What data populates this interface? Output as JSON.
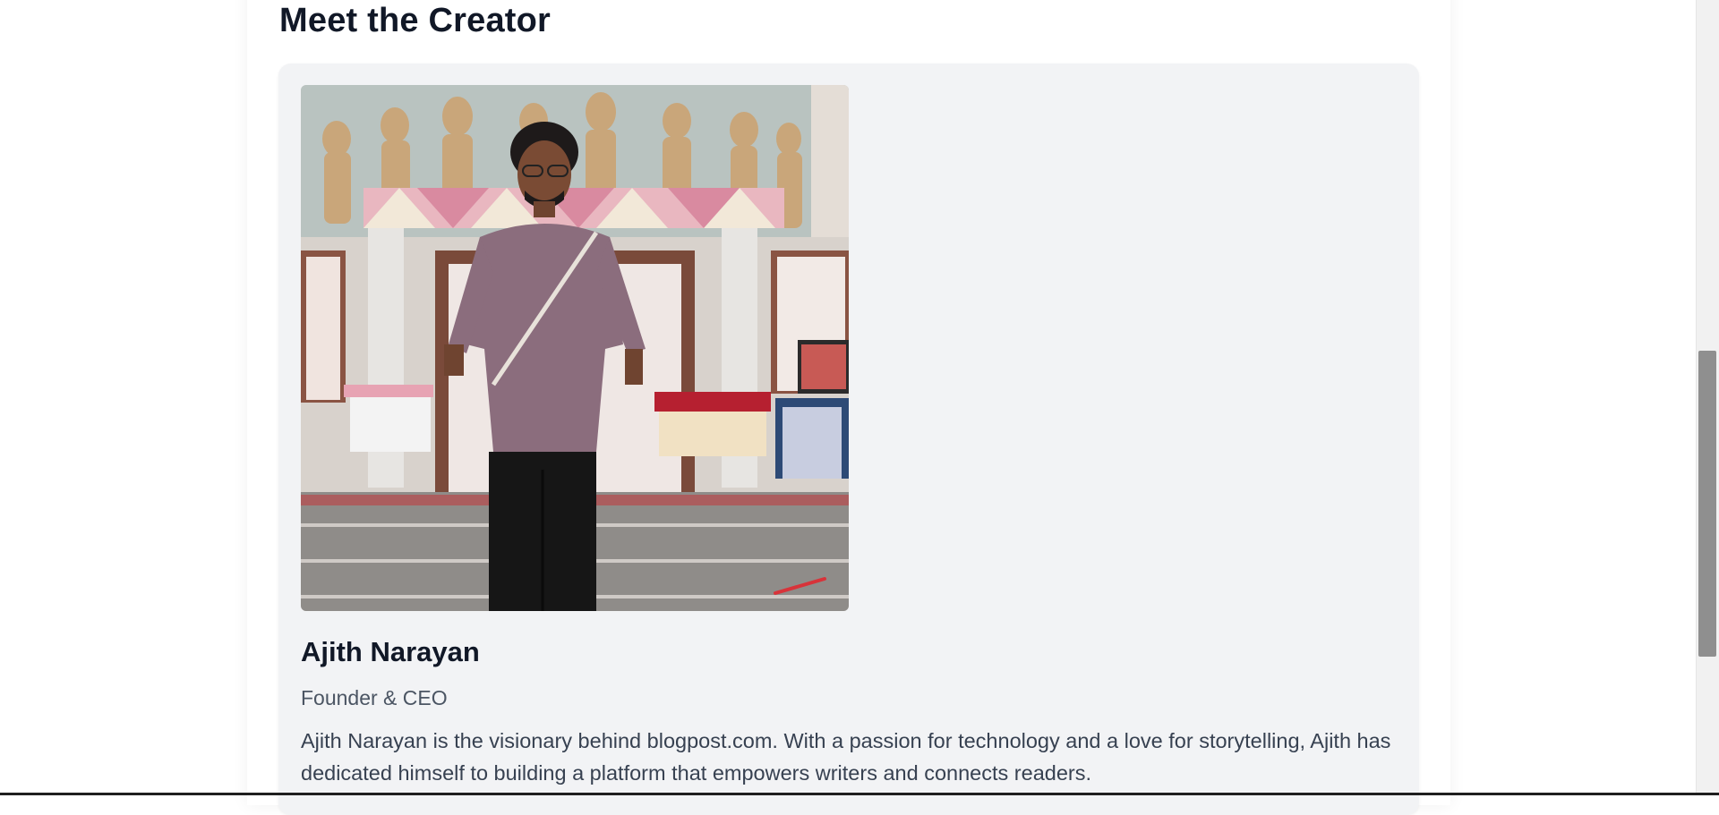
{
  "section": {
    "title": "Meet the Creator"
  },
  "creator": {
    "photo_icon": "creator-portrait",
    "name": "Ajith Narayan",
    "role": "Founder & CEO",
    "bio": "Ajith Narayan is the visionary behind blogpost.com. With a passion for technology and a love for storytelling, Ajith has dedicated himself to building a platform that empowers writers and connects readers."
  },
  "colors": {
    "card_bg": "#f2f3f5",
    "heading": "#111827",
    "role_text": "#4b5563",
    "body_text": "#374151"
  }
}
